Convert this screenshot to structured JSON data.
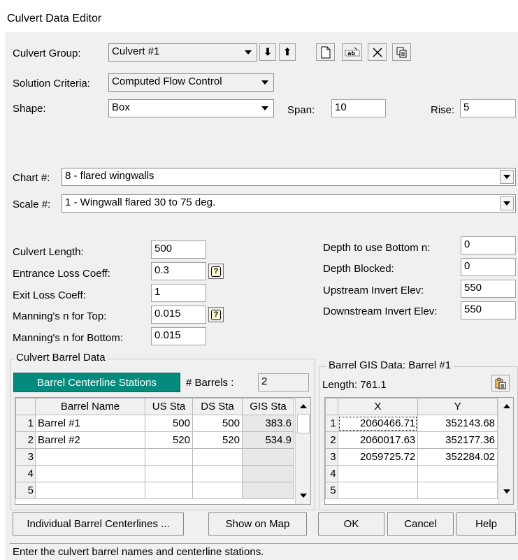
{
  "window": {
    "title": "Culvert Data Editor"
  },
  "culvert_group": {
    "label": "Culvert Group:",
    "value": "Culvert #1"
  },
  "toolbar": {
    "down_arrow": "⬇",
    "up_arrow": "⬆",
    "new_icon": "new-document-icon",
    "rename_icon": "rename-icon",
    "delete_icon": "delete-icon",
    "copy_icon": "copy-icon"
  },
  "solution_criteria": {
    "label": "Solution Criteria:",
    "value": "Computed Flow Control"
  },
  "shape": {
    "label": "Shape:",
    "value": "Box",
    "span_label": "Span:",
    "span_value": "10",
    "rise_label": "Rise:",
    "rise_value": "5"
  },
  "chart": {
    "label": "Chart #:",
    "value": "8 - flared wingwalls"
  },
  "scale": {
    "label": "Scale #:",
    "value": "1 - Wingwall flared 30 to 75 deg."
  },
  "params_left": [
    {
      "label": "Culvert Length:",
      "value": "500",
      "help": false
    },
    {
      "label": "Entrance Loss Coeff:",
      "value": "0.3",
      "help": true
    },
    {
      "label": "Exit Loss Coeff:",
      "value": "1",
      "help": false
    },
    {
      "label": "Manning's n for Top:",
      "value": "0.015",
      "help": true
    },
    {
      "label": "Manning's n for Bottom:",
      "value": "0.015",
      "help": false
    }
  ],
  "params_right": [
    {
      "label": "Depth to use Bottom n:",
      "value": "0"
    },
    {
      "label": "Depth Blocked:",
      "value": "0"
    },
    {
      "label": "Upstream Invert Elev:",
      "value": "550"
    },
    {
      "label": "Downstream Invert Elev:",
      "value": "550"
    }
  ],
  "barrel_data": {
    "title": "Culvert Barrel Data",
    "centerline_button": "Barrel Centerline Stations",
    "barrels_label": "# Barrels :",
    "barrels_value": "2",
    "columns": [
      "Barrel Name",
      "US Sta",
      "DS Sta",
      "GIS Sta"
    ],
    "rows": [
      {
        "n": "1",
        "name": "Barrel #1",
        "us": "500",
        "ds": "500",
        "gis": "383.6"
      },
      {
        "n": "2",
        "name": "Barrel #2",
        "us": "520",
        "ds": "520",
        "gis": "534.9"
      },
      {
        "n": "3",
        "name": "",
        "us": "",
        "ds": "",
        "gis": ""
      },
      {
        "n": "4",
        "name": "",
        "us": "",
        "ds": "",
        "gis": ""
      },
      {
        "n": "5",
        "name": "",
        "us": "",
        "ds": "",
        "gis": ""
      }
    ]
  },
  "gis_data": {
    "title": "Barrel GIS Data: Barrel #1",
    "length_label": "Length: 761.1",
    "paste_icon": "paste-icon",
    "columns": [
      "X",
      "Y"
    ],
    "rows": [
      {
        "n": "1",
        "x": "2060466.71",
        "y": "352143.68"
      },
      {
        "n": "2",
        "x": "2060017.63",
        "y": "352177.36"
      },
      {
        "n": "3",
        "x": "2059725.72",
        "y": "352284.02"
      },
      {
        "n": "4",
        "x": "",
        "y": ""
      },
      {
        "n": "5",
        "x": "",
        "y": ""
      }
    ]
  },
  "buttons": {
    "individual": "Individual Barrel Centerlines ...",
    "show_map": "Show on Map",
    "ok": "OK",
    "cancel": "Cancel",
    "help": "Help"
  },
  "status": "Enter the culvert barrel names and centerline stations."
}
